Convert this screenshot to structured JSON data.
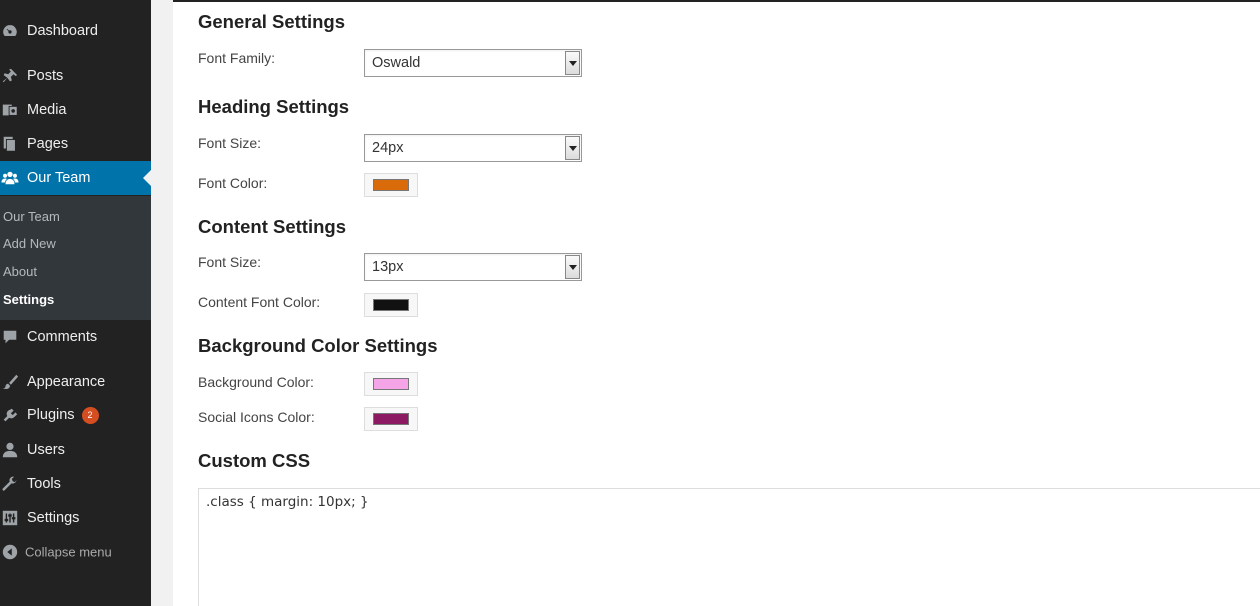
{
  "sidebar": {
    "items": [
      {
        "label": "Dashboard",
        "icon": "dashboard-icon"
      },
      {
        "label": "Posts",
        "icon": "pushpin-icon"
      },
      {
        "label": "Media",
        "icon": "media-icon"
      },
      {
        "label": "Pages",
        "icon": "pages-icon"
      },
      {
        "label": "Our Team",
        "icon": "team-icon"
      },
      {
        "label": "Comments",
        "icon": "comment-icon"
      },
      {
        "label": "Appearance",
        "icon": "paintbrush-icon"
      },
      {
        "label": "Plugins",
        "icon": "plugin-icon",
        "badge": "2"
      },
      {
        "label": "Users",
        "icon": "user-icon"
      },
      {
        "label": "Tools",
        "icon": "wrench-icon"
      },
      {
        "label": "Settings",
        "icon": "settings-icon"
      }
    ],
    "submenu": [
      "Our Team",
      "Add New",
      "About",
      "Settings"
    ],
    "collapse_label": "Collapse menu"
  },
  "settings": {
    "general": {
      "title": "General Settings",
      "font_family_label": "Font Family:",
      "font_family_value": "Oswald"
    },
    "heading": {
      "title": "Heading Settings",
      "font_size_label": "Font Size:",
      "font_size_value": "24px",
      "font_color_label": "Font Color:",
      "font_color": "#d96b0b"
    },
    "content": {
      "title": "Content Settings",
      "font_size_label": "Font Size:",
      "font_size_value": "13px",
      "font_color_label": "Content Font Color:",
      "font_color": "#111111"
    },
    "background": {
      "title": "Background Color Settings",
      "bg_color_label": "Background Color:",
      "bg_color": "#f5a4e8",
      "social_color_label": "Social Icons Color:",
      "social_color": "#8c1a63"
    },
    "custom_css": {
      "title": "Custom CSS",
      "value": ".class { margin: 10px; }"
    }
  },
  "colors": {
    "sidebar_bg": "#222222",
    "sidebar_active": "#0073aa",
    "submenu_bg": "#32373c",
    "badge": "#d54e21"
  }
}
